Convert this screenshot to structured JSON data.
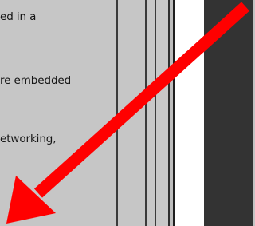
{
  "document": {
    "lines": [
      "ed in a",
      "re embedded",
      "etworking,"
    ]
  },
  "overlay": {
    "arrow_color": "#ff0000",
    "arrow_icon": "arrow-down-left-icon"
  },
  "colors": {
    "content_background": "#c6c6c6",
    "dark_panel": "#333333",
    "divider": "#3a3a3a"
  }
}
